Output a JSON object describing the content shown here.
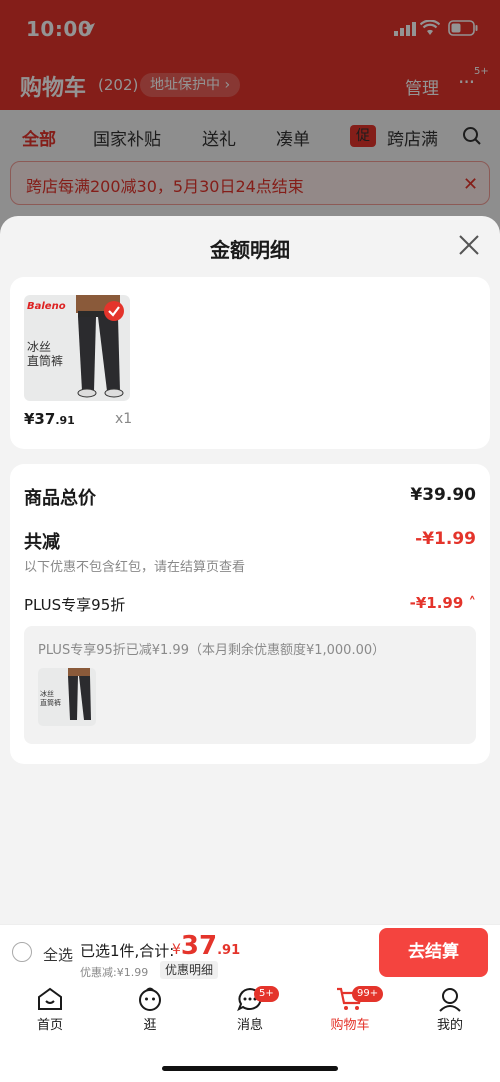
{
  "status_bar": {
    "time": "10:00"
  },
  "cart_header": {
    "title": "购物车",
    "count": "(202)",
    "address_chip": "地址保护中",
    "manage_label": "管理",
    "more_badge": "5+"
  },
  "filter_tabs": {
    "all": "全部",
    "subsidy": "国家补贴",
    "gift": "送礼",
    "combine": "凑单",
    "promo_tag": "促",
    "cross_store": "跨店满"
  },
  "banner": {
    "text": "跨店每满200减30，5月30日24点结束"
  },
  "sheet": {
    "title": "金额明细",
    "product": {
      "brand": "Baleno",
      "caption": "冰丝\n直筒裤",
      "price_int": "¥37",
      "price_dec": ".91",
      "qty": "x1"
    },
    "total_label": "商品总价",
    "total_value": "¥39.90",
    "reduce_label": "共减",
    "reduce_value": "-¥1.99",
    "note": "以下优惠不包含红包，请在结算页查看",
    "plus_label": "PLUS专享95折",
    "plus_value": "-¥1.99",
    "plus_detail": "PLUS专享95折已减¥1.99（本月剩余优惠额度¥1,000.00）"
  },
  "checkout": {
    "select_all": "全选",
    "selected_info": "已选1件,合计:",
    "total_currency": "¥",
    "total_int": "37",
    "total_dec": ".91",
    "discount": "优惠减:¥1.99",
    "detail_chip": "优惠明细",
    "go_label": "去结算"
  },
  "tabbar": {
    "home": "首页",
    "browse": "逛",
    "messages": "消息",
    "messages_badge": "5+",
    "cart": "购物车",
    "cart_badge": "99+",
    "mine": "我的"
  },
  "colors": {
    "accent": "#e4342b",
    "button": "#f4443f"
  }
}
